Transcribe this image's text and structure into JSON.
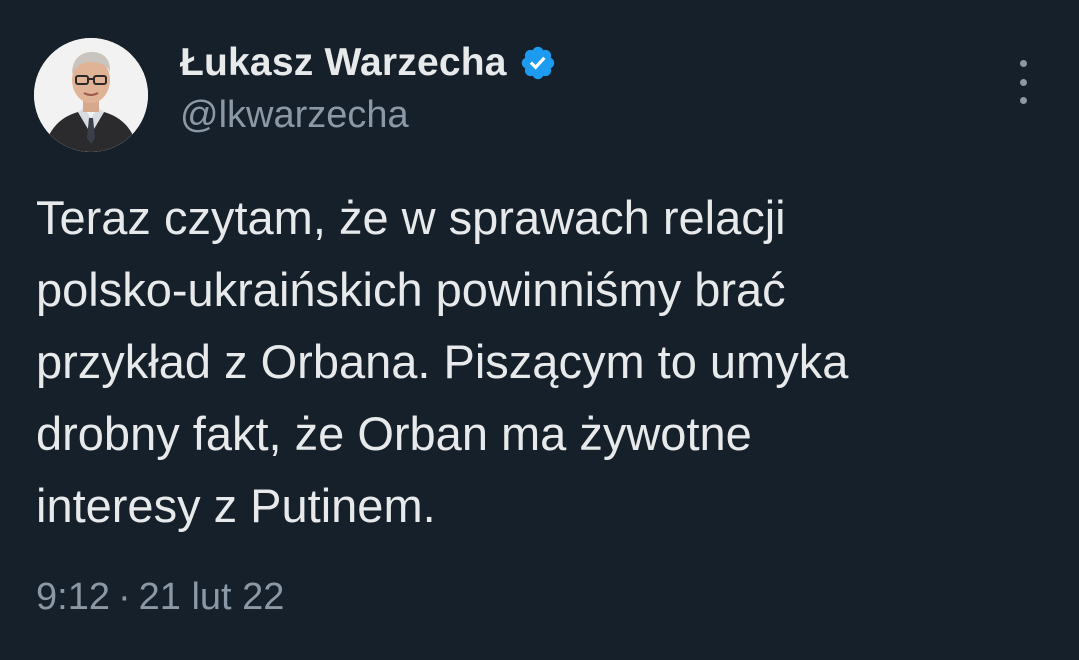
{
  "author": {
    "display_name": "Łukasz Warzecha",
    "handle": "@lkwarzecha",
    "verified": true,
    "verified_color": "#1d9bf0"
  },
  "tweet": {
    "lines": [
      "Teraz czytam, że w sprawach relacji",
      "polsko-ukraińskich powinniśmy brać",
      "przykład z Orbana. Piszącym to umyka",
      "drobny fakt, że Orban ma żywotne",
      "interesy z Putinem."
    ]
  },
  "meta": {
    "time": "9:12",
    "separator": "·",
    "date": "21 lut 22"
  },
  "icons": {
    "avatar": "profile-photo",
    "verified": "verified-badge-icon",
    "more": "more-options-icon"
  },
  "colors": {
    "background": "#15202b",
    "primary_text": "#e7e9ea",
    "secondary_text": "#8b98a5"
  }
}
